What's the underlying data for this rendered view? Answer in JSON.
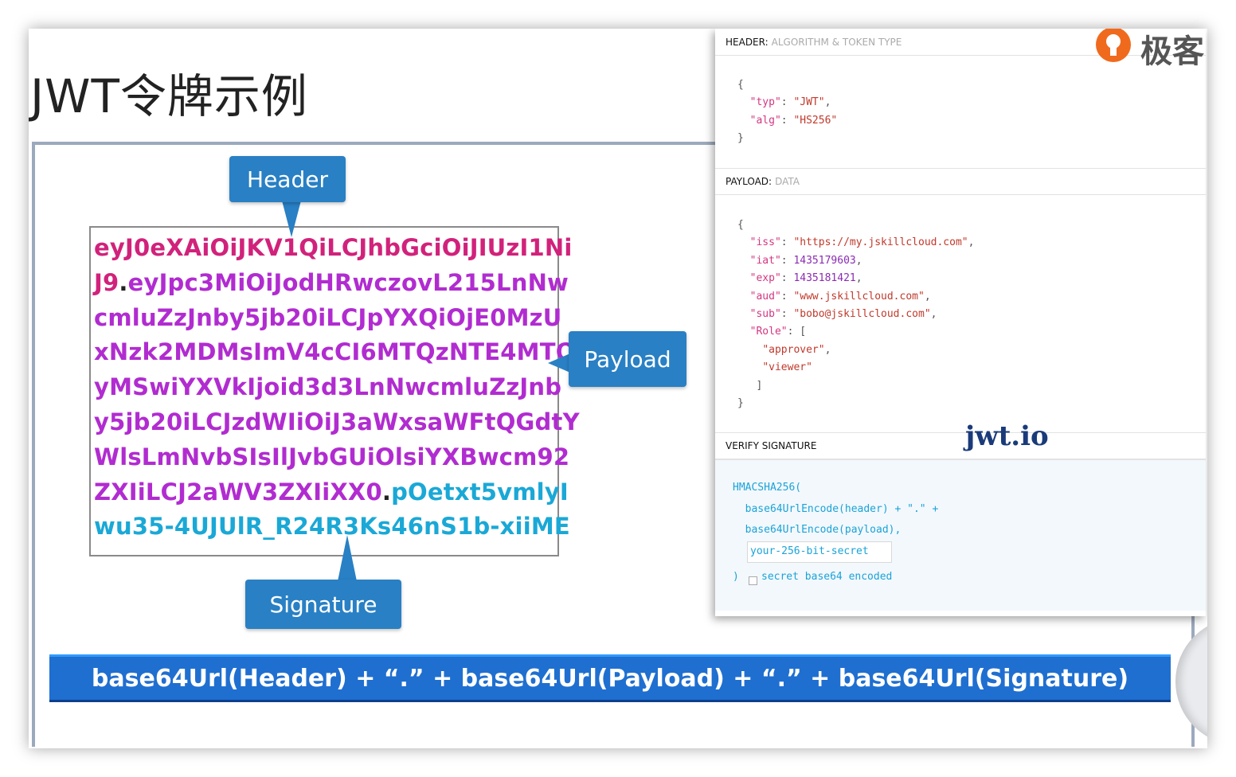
{
  "slide": {
    "title": "JWT令牌示例"
  },
  "token": {
    "lines": [
      {
        "segments": [
          {
            "type": "header",
            "text": "eyJ0eXAiOiJKV1QiLCJhbGciOiJIUzI1Ni"
          }
        ]
      },
      {
        "segments": [
          {
            "type": "header",
            "text": "J9"
          },
          {
            "type": "dot",
            "text": "."
          },
          {
            "type": "payload",
            "text": "eyJpc3MiOiJodHRwczovL215LnNw"
          }
        ]
      },
      {
        "segments": [
          {
            "type": "payload",
            "text": "cmluZzJnby5jb20iLCJpYXQiOjE0MzU"
          }
        ]
      },
      {
        "segments": [
          {
            "type": "payload",
            "text": "xNzk2MDMsImV4cCI6MTQzNTE4MTQ"
          }
        ]
      },
      {
        "segments": [
          {
            "type": "payload",
            "text": "yMSwiYXVkIjoid3d3LnNwcmluZzJnb"
          }
        ]
      },
      {
        "segments": [
          {
            "type": "payload",
            "text": "y5jb20iLCJzdWIiOiJ3aWxsaWFtQGdtY"
          }
        ]
      },
      {
        "segments": [
          {
            "type": "payload",
            "text": "WlsLmNvbSIsIlJvbGUiOlsiYXBwcm92"
          }
        ]
      },
      {
        "segments": [
          {
            "type": "payload",
            "text": "ZXIiLCJ2aWV3ZXIiXX0"
          },
          {
            "type": "dot",
            "text": "."
          },
          {
            "type": "sig",
            "text": "pOetxt5vmlyI"
          }
        ]
      },
      {
        "segments": [
          {
            "type": "sig",
            "text": "wu35-4UJUlR_R24R3Ks46nS1b-xiiME"
          }
        ]
      }
    ]
  },
  "callouts": {
    "header": "Header",
    "payload": "Payload",
    "signature": "Signature"
  },
  "formula": "base64Url(Header) +  “.”  + base64Url(Payload) +  “.”  + base64Url(Signature)",
  "panel": {
    "header_title": "HEADER:",
    "header_sub": "ALGORITHM & TOKEN TYPE",
    "header_json": [
      {
        "t": "p",
        "v": "{"
      },
      {
        "t": "kv",
        "k": "\"typ\"",
        "v": "\"JWT\"",
        "vt": "s",
        "end": ","
      },
      {
        "t": "kv",
        "k": "\"alg\"",
        "v": "\"HS256\"",
        "vt": "s",
        "end": ""
      },
      {
        "t": "p",
        "v": "}"
      }
    ],
    "payload_title": "PAYLOAD:",
    "payload_sub": "DATA",
    "payload_json": [
      {
        "t": "p",
        "v": "{"
      },
      {
        "t": "kv",
        "k": "\"iss\"",
        "v": "\"https://my.jskillcloud.com\"",
        "vt": "s",
        "end": ","
      },
      {
        "t": "kv",
        "k": "\"iat\"",
        "v": "1435179603",
        "vt": "n",
        "end": ","
      },
      {
        "t": "kv",
        "k": "\"exp\"",
        "v": "1435181421",
        "vt": "n",
        "end": ","
      },
      {
        "t": "kv",
        "k": "\"aud\"",
        "v": "\"www.jskillcloud.com\"",
        "vt": "s",
        "end": ","
      },
      {
        "t": "kv",
        "k": "\"sub\"",
        "v": "\"bobo@jskillcloud.com\"",
        "vt": "s",
        "end": ","
      },
      {
        "t": "kv",
        "k": "\"Role\"",
        "v": "[",
        "vt": "p",
        "end": ""
      },
      {
        "t": "item",
        "v": "\"approver\"",
        "end": ","
      },
      {
        "t": "item",
        "v": "\"viewer\"",
        "end": ""
      },
      {
        "t": "close",
        "v": "]"
      },
      {
        "t": "p",
        "v": "}"
      }
    ],
    "verify_title": "VERIFY SIGNATURE",
    "jwtio": "jwt.io",
    "verify_lines": [
      "HMACSHA256(",
      "  base64UrlEncode(header) + \".\" +",
      "  base64UrlEncode(payload),"
    ],
    "secret_value": "your-256-bit-secret",
    "close_paren": ")",
    "secret_label": "secret base64 encoded"
  },
  "brand": {
    "name": "极客",
    "color": "#f06a1d"
  },
  "colors": {
    "header_seg": "#d1227b",
    "payload_seg": "#b12cd0",
    "signature_seg": "#1aa8d6",
    "callout": "#2980c4",
    "formula_bar": "#1f6fd0"
  }
}
